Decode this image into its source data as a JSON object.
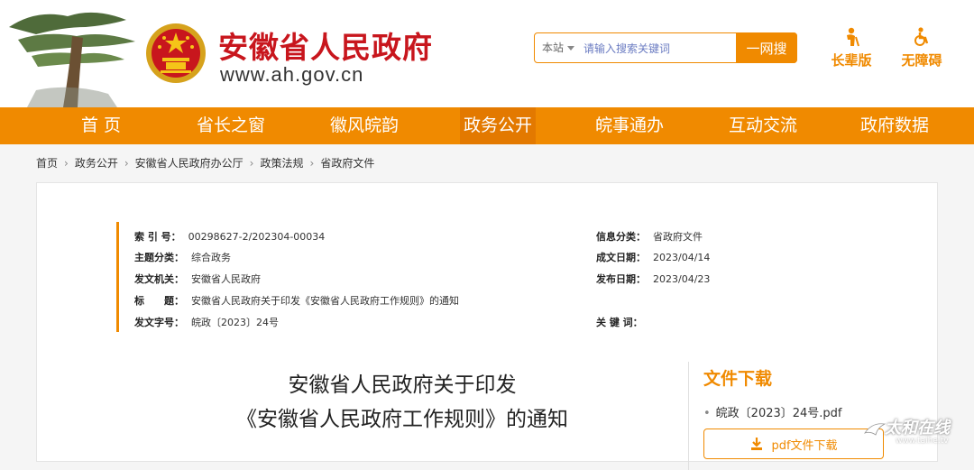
{
  "header": {
    "site_title": "安徽省人民政府",
    "site_url": "www.ah.gov.cn",
    "search": {
      "scope": "本站",
      "placeholder": "请输入搜索关键词",
      "button_label": "一网搜"
    },
    "tools": [
      {
        "label": "长辈版",
        "icon": "elder-icon"
      },
      {
        "label": "无障碍",
        "icon": "wheelchair-icon"
      }
    ]
  },
  "nav": {
    "items": [
      {
        "label": "首 页"
      },
      {
        "label": "省长之窗"
      },
      {
        "label": "徽风皖韵"
      },
      {
        "label": "政务公开",
        "active": true
      },
      {
        "label": "皖事通办"
      },
      {
        "label": "互动交流"
      },
      {
        "label": "政府数据"
      }
    ]
  },
  "breadcrumb": [
    "首页",
    "政务公开",
    "安徽省人民政府办公厅",
    "政策法规",
    "省政府文件"
  ],
  "meta": {
    "index_no": {
      "label": "索 引 号：",
      "value": "00298627-2/202304-00034"
    },
    "topic": {
      "label": "主题分类：",
      "value": "综合政务"
    },
    "issuer": {
      "label": "发文机关：",
      "value": "安徽省人民政府"
    },
    "title": {
      "label": "标　　题：",
      "value": "安徽省人民政府关于印发《安徽省人民政府工作规则》的通知"
    },
    "doc_no": {
      "label": "发文字号：",
      "value": "皖政〔2023〕24号"
    },
    "info_category": {
      "label": "信息分类：",
      "value": "省政府文件"
    },
    "created_date": {
      "label": "成文日期：",
      "value": "2023/04/14"
    },
    "published_date": {
      "label": "发布日期：",
      "value": "2023/04/23"
    },
    "keywords": {
      "label": "关 键 词：",
      "value": ""
    }
  },
  "document": {
    "title_line1": "安徽省人民政府关于印发",
    "title_line2": "《安徽省人民政府工作规则》的通知"
  },
  "download": {
    "heading": "文件下载",
    "file_name": "皖政〔2023〕24号.pdf",
    "button_label": "pdf文件下载"
  },
  "watermark": {
    "text": "太和在线",
    "url": "www.taihe.tv"
  },
  "colors": {
    "brand_orange": "#f08a00",
    "title_red": "#c8161d"
  }
}
